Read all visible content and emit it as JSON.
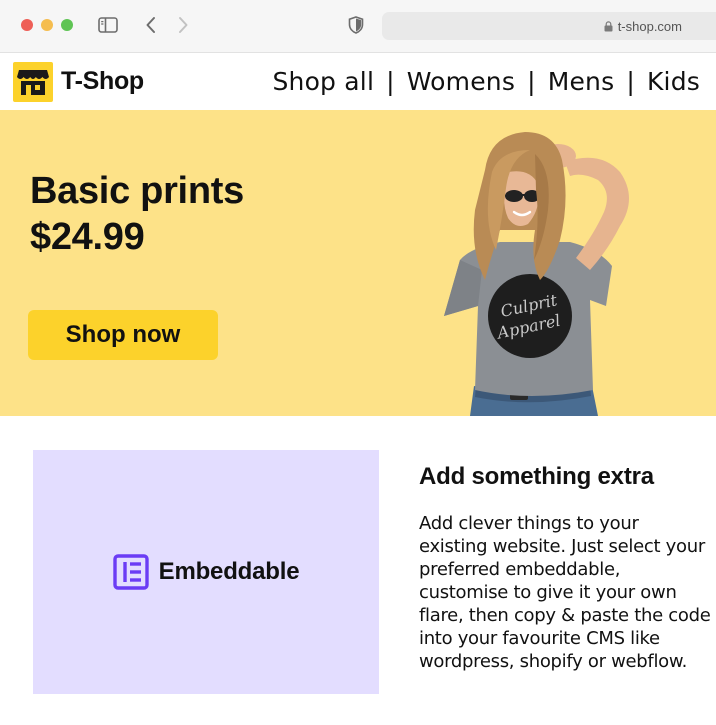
{
  "browser": {
    "url": "t-shop.com",
    "icons": [
      "sidebar-icon",
      "back-arrow-icon",
      "forward-arrow-icon",
      "shield-icon",
      "lock-icon"
    ]
  },
  "header": {
    "brand": "T-Shop",
    "nav": [
      {
        "label": "Shop all"
      },
      {
        "label": "Womens"
      },
      {
        "label": "Mens"
      },
      {
        "label": "Kids"
      }
    ],
    "separator": "|"
  },
  "hero": {
    "title_line1": "Basic prints",
    "price": "$24.99",
    "cta": "Shop now",
    "shirt_print": "Culprit Apparel"
  },
  "feature": {
    "logo_text": "Embeddable",
    "title": "Add something extra",
    "body": "Add clever things to your existing website. Just select your preferred embeddable, customise to give it your own flare, then copy & paste the code into your favourite CMS like wordpress, shopify or webflow."
  },
  "colors": {
    "hero_bg": "#fde288",
    "accent_yellow": "#fcd22b",
    "embed_bg": "#e3ddff",
    "embed_purple": "#6b3cf5"
  }
}
